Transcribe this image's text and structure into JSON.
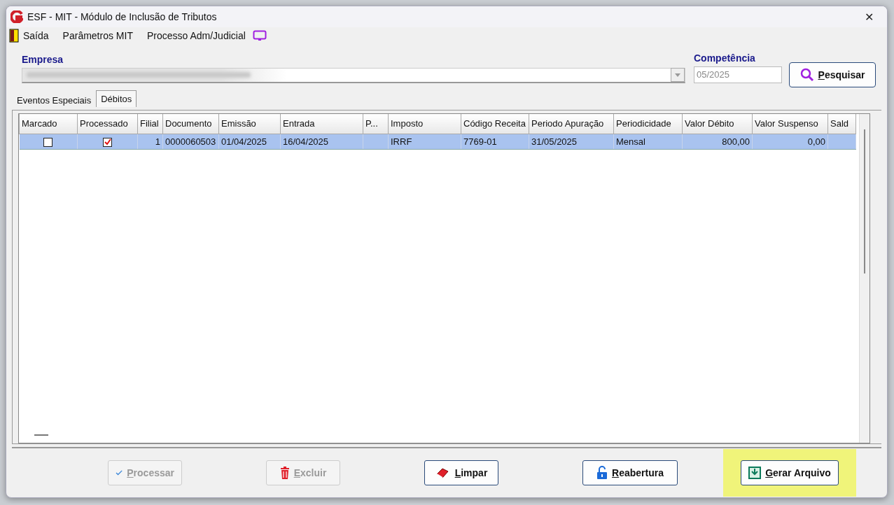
{
  "window": {
    "title": "ESF - MIT - Módulo de Inclusão de Tributos",
    "close": "✕"
  },
  "menu": [
    {
      "label": "Saída"
    },
    {
      "label": "Parâmetros MIT"
    },
    {
      "label": "Processo Adm/Judicial"
    }
  ],
  "empresa": {
    "label": "Empresa"
  },
  "competencia": {
    "label": "Competência",
    "value": "05/2025"
  },
  "search_button": {
    "label": "Pesquisar"
  },
  "tabs": [
    {
      "label": "Eventos Especiais",
      "selected": false
    },
    {
      "label": "Débitos",
      "selected": true
    }
  ],
  "table": {
    "columns": [
      "Marcado",
      "Processado",
      "Filial",
      "Documento",
      "Emissão",
      "Entrada",
      "P...",
      "Imposto",
      "Código Receita",
      "Periodo Apuração",
      "Periodicidade",
      "Valor Débito",
      "Valor Suspenso",
      "Sald"
    ],
    "rows": [
      {
        "selected": true,
        "cells": [
          {
            "kind": "check",
            "checked": false
          },
          {
            "kind": "check",
            "checked": true
          },
          {
            "kind": "number",
            "text": "1"
          },
          {
            "kind": "text",
            "text": "0000060503"
          },
          {
            "kind": "text",
            "text": "01/04/2025"
          },
          {
            "kind": "text",
            "text": "16/04/2025"
          },
          {
            "kind": "empty"
          },
          {
            "kind": "text",
            "text": "IRRF"
          },
          {
            "kind": "text",
            "text": "7769-01"
          },
          {
            "kind": "text",
            "text": "31/05/2025"
          },
          {
            "kind": "text",
            "text": "Mensal"
          },
          {
            "kind": "number",
            "text": "800,00"
          },
          {
            "kind": "number",
            "text": "0,00"
          },
          {
            "kind": "empty"
          }
        ]
      }
    ]
  },
  "buttons": [
    {
      "label": "Processar",
      "disabled": true,
      "highlighted": false
    },
    {
      "label": "Excluir",
      "disabled": true,
      "highlighted": false
    },
    {
      "label": "Limpar",
      "disabled": false,
      "highlighted": false
    },
    {
      "label": "Reabertura",
      "disabled": false,
      "highlighted": false
    },
    {
      "label": "Gerar Arquivo",
      "disabled": false,
      "highlighted": true
    }
  ]
}
